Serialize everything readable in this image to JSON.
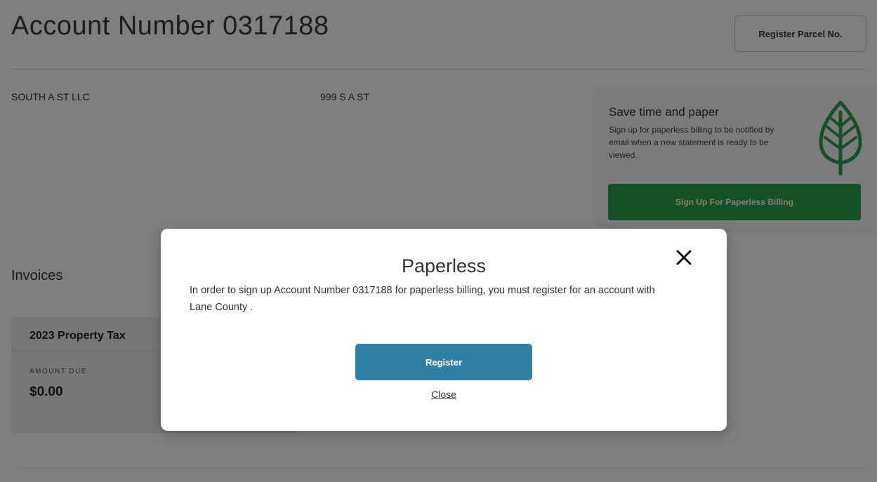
{
  "header": {
    "title": "Account Number 0317188",
    "register_parcel_label": "Register Parcel No."
  },
  "account": {
    "owner": "SOUTH A ST LLC",
    "address": "999 S A ST"
  },
  "paperless_promo": {
    "title": "Save time and paper",
    "text": "Sign up for paperless billing to be notified by email when a new statement is ready to be viewed.",
    "button_label": "Sign Up For Paperless Billing",
    "icon": "leaf-icon",
    "accent_color": "#2ba24c"
  },
  "invoices": {
    "heading": "Invoices",
    "items": [
      {
        "title": "2023 Property Tax",
        "amount_label": "AMOUNT DUE",
        "amount": "$0.00"
      }
    ]
  },
  "modal": {
    "title": "Paperless",
    "message": "In order to sign up Account Number 0317188 for paperless billing, you must register for an account with Lane County .",
    "register_label": "Register",
    "close_label": "Close",
    "close_icon": "close-icon",
    "primary_color": "#2f7fa2"
  }
}
